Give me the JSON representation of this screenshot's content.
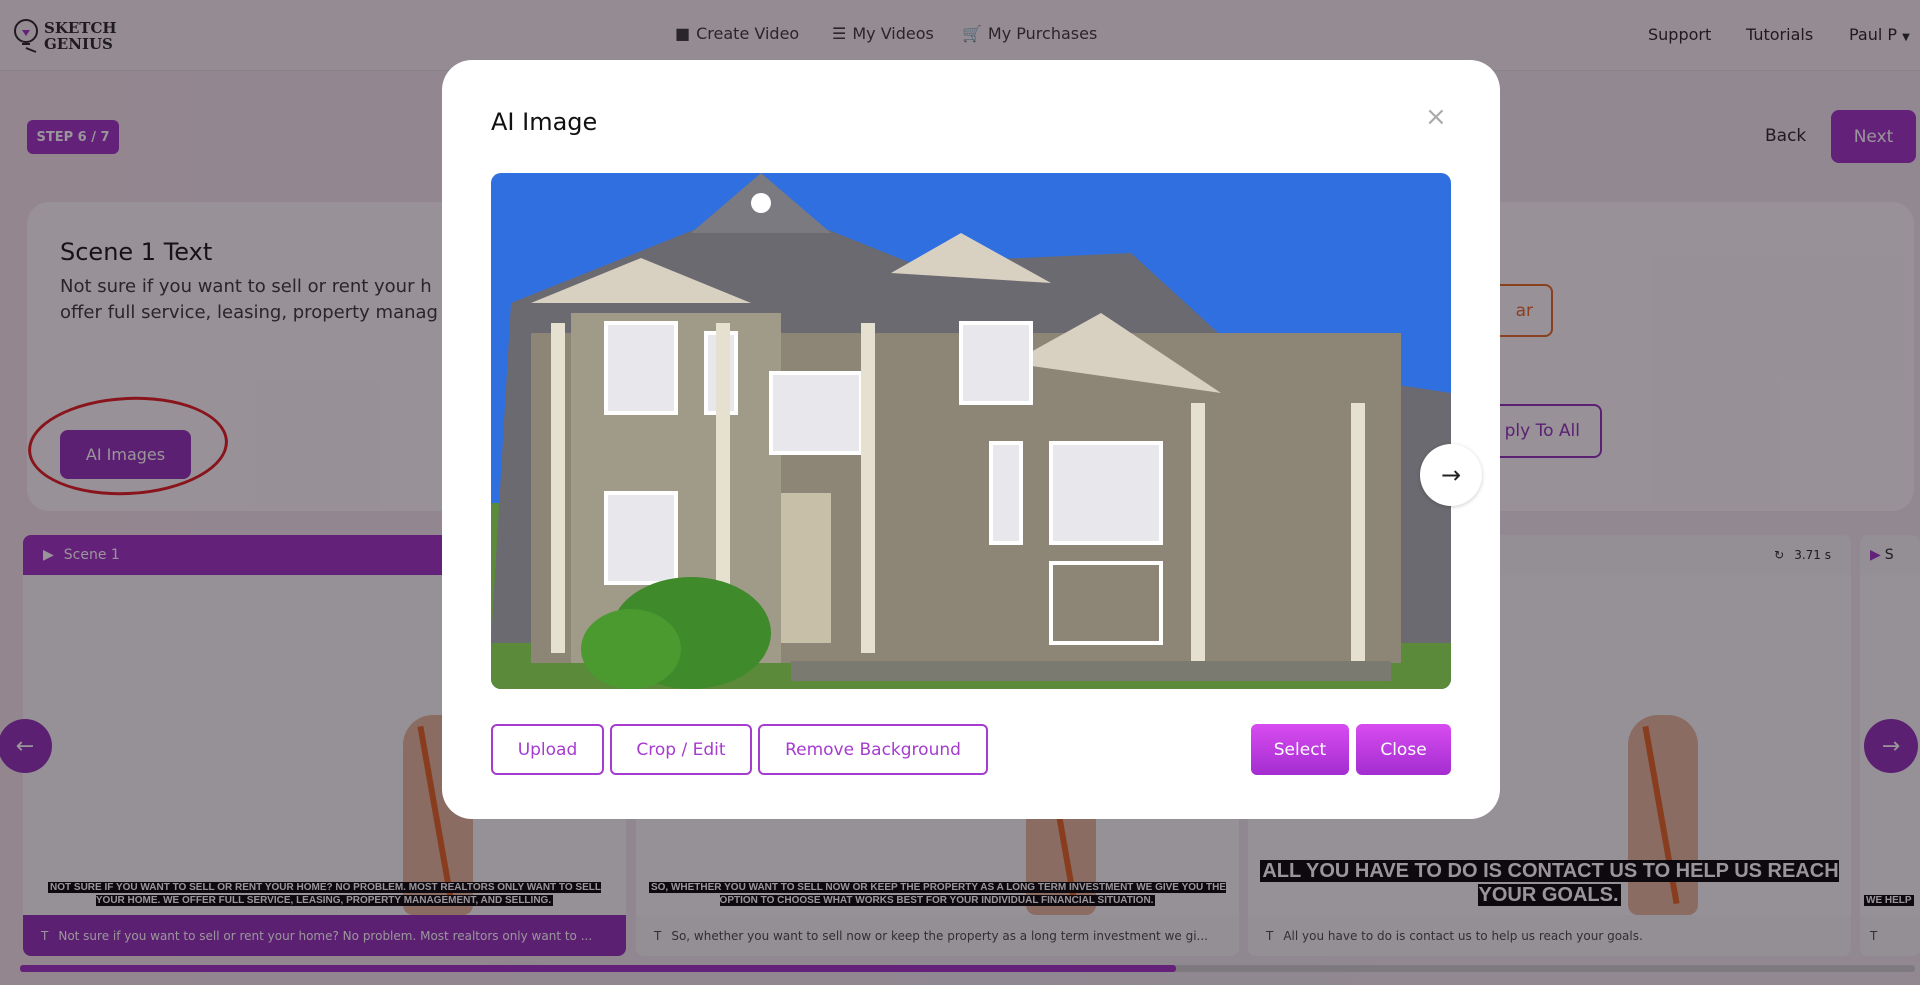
{
  "header": {
    "logo_text": "SKETCH GENIUS",
    "nav": [
      {
        "label": "Create Video",
        "icon": "video-camera-icon"
      },
      {
        "label": "My Videos",
        "icon": "list-icon"
      },
      {
        "label": "My Purchases",
        "icon": "cart-icon"
      }
    ],
    "support": "Support",
    "tutorials": "Tutorials",
    "user": "Paul P"
  },
  "step": {
    "label": "STEP 6 / 7",
    "back": "Back",
    "next": "Next"
  },
  "scene_panel": {
    "title": "Scene 1 Text",
    "text_line1": "Not sure if you want to sell or rent your h",
    "text_line2": "offer full service, leasing, property manag",
    "ai_images": "AI Images",
    "clear": "ar",
    "apply": "ply To All"
  },
  "scenes": [
    {
      "header": "Scene 1",
      "caption": "Not sure if you want to sell or rent your home? No problem. Most realtors only want to sell your home. We offer full service, leasing, property management, and selling.",
      "text": "Not sure if you want to sell or rent your home? No problem. Most realtors only want to ..."
    },
    {
      "header": "",
      "caption": "So, whether you want to sell now or keep the property as a long term investment we give you the option to choose what works best for your individual financial situation.",
      "text": "So, whether you want to sell now or keep the property as a long term investment we gi..."
    },
    {
      "header": "",
      "duration": "3.71 s",
      "caption": "All you have to do is contact us to help us reach your goals.",
      "text": "All you have to do is contact us to help us reach your goals."
    },
    {
      "header": "S",
      "caption": "We help",
      "text": ""
    }
  ],
  "progress": 0.61,
  "modal": {
    "title": "AI Image",
    "close_icon": "×",
    "next_icon": "→",
    "buttons": {
      "upload": "Upload",
      "crop": "Crop / Edit",
      "remove_bg": "Remove Background",
      "select": "Select",
      "close": "Close"
    }
  },
  "colors": {
    "accent": "#9b2cc4",
    "button_gradient": "#d84cf0",
    "clear": "#e0641e",
    "annotation": "#e0151a"
  }
}
